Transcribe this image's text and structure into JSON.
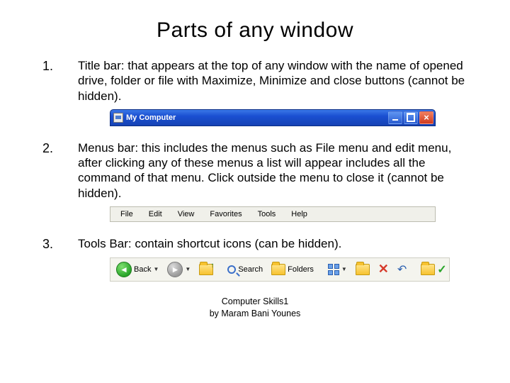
{
  "title": "Parts of any window",
  "items": [
    {
      "num": "1.",
      "label": "Title bar:",
      "text": " that appears at the top of any window with the name of opened drive, folder or file with Maximize, Minimize and close buttons (cannot be hidden)."
    },
    {
      "num": "2.",
      "label": "Menus bar:",
      "text": " this includes the menus such as File menu and edit menu, after clicking any of these menus a list will appear includes all the command of that menu. Click outside the menu to close it (cannot be hidden)."
    },
    {
      "num": "3.",
      "label": "Tools Bar:",
      "text": " contain shortcut icons (can be hidden)."
    }
  ],
  "titlebar": {
    "caption": "My Computer"
  },
  "menubar": {
    "items": [
      "File",
      "Edit",
      "View",
      "Favorites",
      "Tools",
      "Help"
    ]
  },
  "toolbar": {
    "back": "Back",
    "search": "Search",
    "folders": "Folders"
  },
  "footer": {
    "line1": "Computer Skills1",
    "line2": "by Maram Bani Younes"
  }
}
